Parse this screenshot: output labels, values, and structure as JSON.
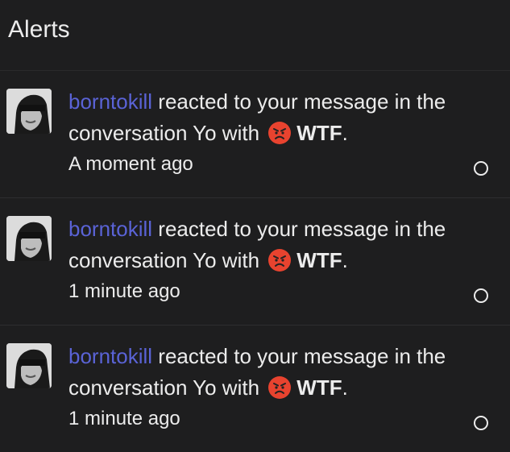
{
  "header": {
    "title": "Alerts"
  },
  "alerts": [
    {
      "username": "borntokill",
      "text_before": " reacted to your message in the conversation Yo with ",
      "reaction": "WTF",
      "text_after": ".",
      "time": "A moment ago"
    },
    {
      "username": "borntokill",
      "text_before": " reacted to your message in the conversation Yo with ",
      "reaction": "WTF",
      "text_after": ".",
      "time": "1 minute ago"
    },
    {
      "username": "borntokill",
      "text_before": " reacted to your message in the conversation Yo with ",
      "reaction": "WTF",
      "text_after": ".",
      "time": "1 minute ago"
    }
  ],
  "icons": {
    "reaction": "angry-face-icon",
    "read_toggle": "circle-outline-icon"
  },
  "colors": {
    "background": "#1e1e1f",
    "username": "#5a63d6",
    "text": "#ececec",
    "emoji_face": "#e8432f"
  }
}
